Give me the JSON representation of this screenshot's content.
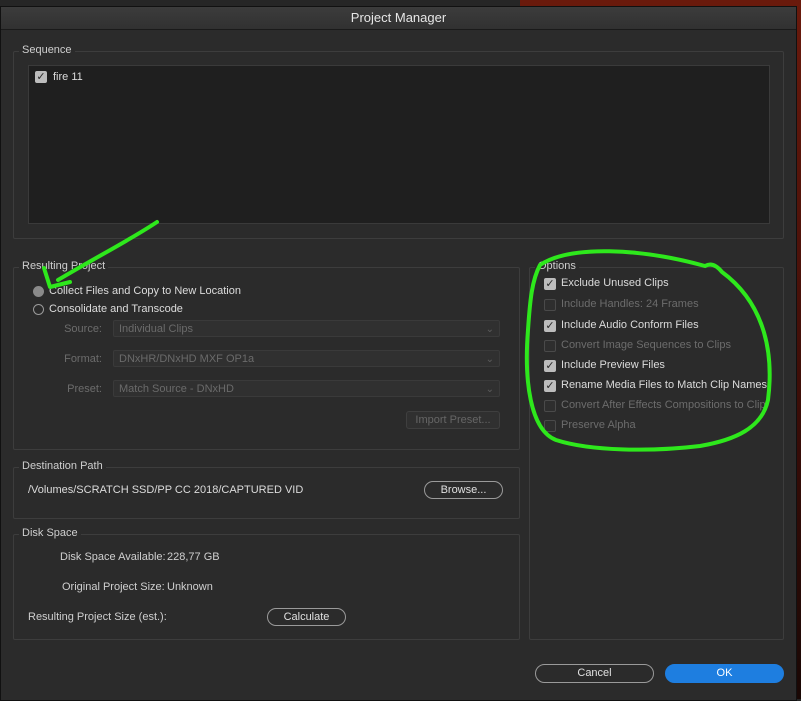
{
  "window": {
    "title": "Project Manager"
  },
  "sequence": {
    "group_label": "Sequence",
    "items": [
      {
        "label": "fire 11",
        "checked": true
      }
    ]
  },
  "resulting_project": {
    "group_label": "Resulting Project",
    "option_collect": "Collect Files and Copy to New Location",
    "option_consolidate": "Consolidate and Transcode",
    "selected": "collect",
    "source_label": "Source:",
    "source_value": "Individual Clips",
    "format_label": "Format:",
    "format_value": "DNxHR/DNxHD MXF OP1a",
    "preset_label": "Preset:",
    "preset_value": "Match Source - DNxHD",
    "import_preset": "Import Preset..."
  },
  "options": {
    "group_label": "Options",
    "items": [
      {
        "label": "Exclude Unused Clips",
        "checked": true,
        "enabled": true
      },
      {
        "label": "Include Handles:  24 Frames",
        "checked": false,
        "enabled": false
      },
      {
        "label": "Include Audio Conform Files",
        "checked": true,
        "enabled": true
      },
      {
        "label": "Convert Image Sequences to Clips",
        "checked": false,
        "enabled": false
      },
      {
        "label": "Include Preview Files",
        "checked": true,
        "enabled": true
      },
      {
        "label": "Rename Media Files to Match Clip Names",
        "checked": true,
        "enabled": true
      },
      {
        "label": "Convert After Effects Compositions to Clip",
        "checked": false,
        "enabled": false
      },
      {
        "label": "Preserve Alpha",
        "checked": false,
        "enabled": false
      }
    ]
  },
  "destination": {
    "group_label": "Destination Path",
    "path": "/Volumes/SCRATCH SSD/PP CC 2018/CAPTURED VID",
    "browse": "Browse..."
  },
  "disk_space": {
    "group_label": "Disk Space",
    "available_label": "Disk Space Available:",
    "available_value": "228,77 GB",
    "original_label": "Original Project Size:",
    "original_value": "Unknown",
    "resulting_label": "Resulting Project Size (est.):",
    "calculate": "Calculate"
  },
  "footer": {
    "cancel": "Cancel",
    "ok": "OK"
  },
  "annotation": {
    "color": "#2ee81c"
  }
}
